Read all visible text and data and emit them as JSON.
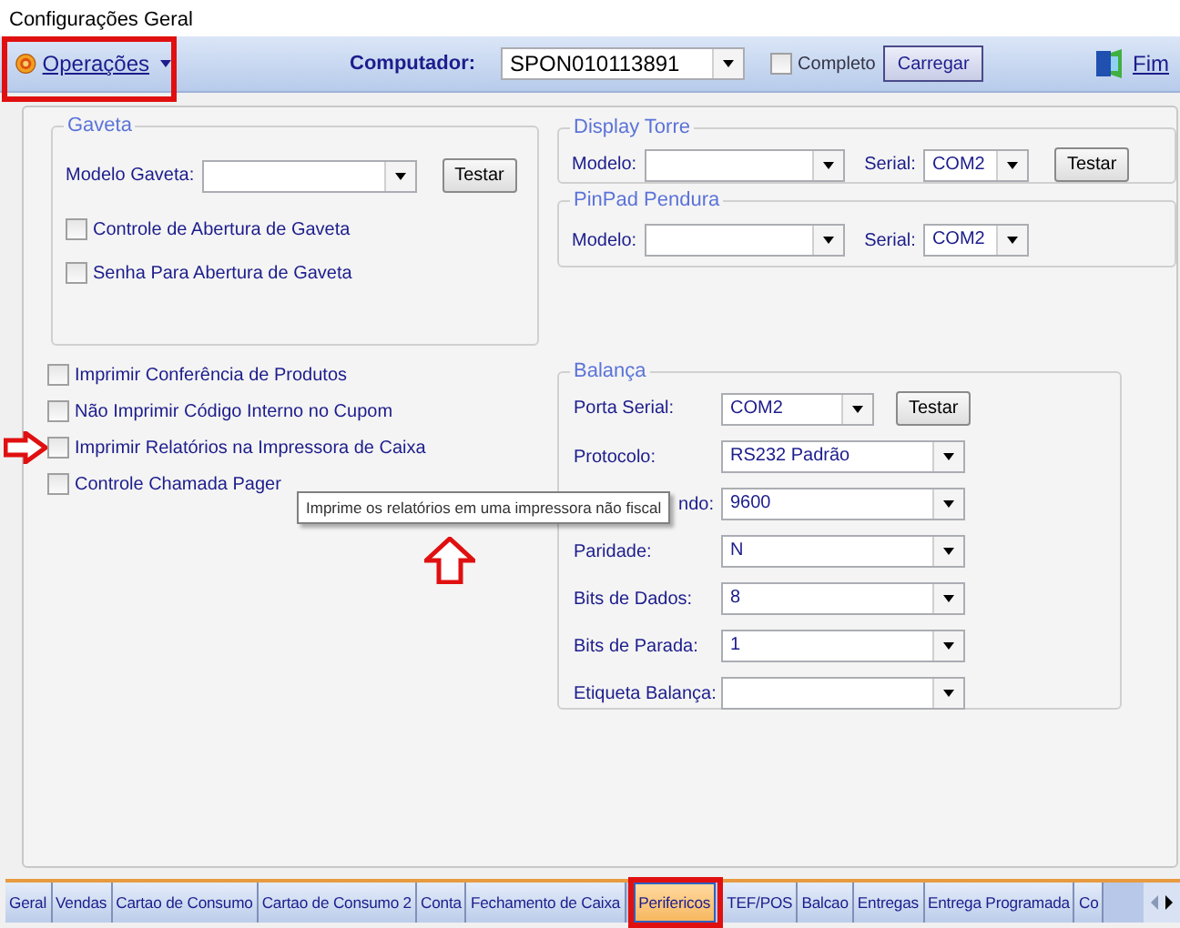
{
  "window": {
    "title": "Configurações Geral"
  },
  "toolbar": {
    "menu_button": "Operações",
    "computer_label": "Computador:",
    "computer_value": "SPON010113891",
    "complete": {
      "label": "Completo",
      "checked": false
    },
    "load_button": "Carregar",
    "exit_button": "Fim"
  },
  "gaveta": {
    "title": "Gaveta",
    "model_label": "Modelo Gaveta:",
    "test_button": "Testar",
    "options": [
      {
        "label": "Controle de Abertura de Gaveta",
        "checked": false
      },
      {
        "label": "Senha Para Abertura de Gaveta",
        "checked": false
      }
    ]
  },
  "options": [
    {
      "label": "Imprimir Conferência de Produtos",
      "checked": false
    },
    {
      "label": "Não Imprimir Código Interno no Cupom",
      "checked": false
    },
    {
      "label": "Imprimir Relatórios na Impressora de Caixa",
      "checked": false
    },
    {
      "label": "Controle Chamada Pager",
      "checked": false
    }
  ],
  "display_torre": {
    "title": "Display Torre",
    "model_label": "Modelo:",
    "serial_label": "Serial:",
    "serial_value": "COM2",
    "test_button": "Testar"
  },
  "pinpad": {
    "title": "PinPad Pendura",
    "model_label": "Modelo:",
    "serial_label": "Serial:",
    "serial_value": "COM2"
  },
  "balanca": {
    "title": "Balança",
    "test_button": "Testar",
    "fields": [
      {
        "label": "Porta Serial:",
        "value": "COM2"
      },
      {
        "label": "Protocolo:",
        "value": "RS232 Padrão"
      },
      {
        "label": "ndo:",
        "value": "9600"
      },
      {
        "label": "Paridade:",
        "value": "N"
      },
      {
        "label": "Bits de Dados:",
        "value": "8"
      },
      {
        "label": "Bits de Parada:",
        "value": "1"
      },
      {
        "label": "Etiqueta Balança:"
      }
    ]
  },
  "tooltip": "Imprime os relatórios em uma impressora não fiscal",
  "tabs": [
    {
      "label": "Geral",
      "selected": false
    },
    {
      "label": "Vendas",
      "selected": false
    },
    {
      "label": "Cartao de Consumo",
      "selected": false
    },
    {
      "label": "Cartao de Consumo 2",
      "selected": false
    },
    {
      "label": "Conta",
      "selected": false
    },
    {
      "label": "Fechamento de Caixa",
      "selected": false
    },
    {
      "label": "Perifericos",
      "selected": true
    },
    {
      "label": "TEF/POS",
      "selected": false
    },
    {
      "label": "Balcao",
      "selected": false
    },
    {
      "label": "Entregas",
      "selected": false
    },
    {
      "label": "Entrega Programada",
      "selected": false
    },
    {
      "label": "Co",
      "selected": false
    }
  ]
}
